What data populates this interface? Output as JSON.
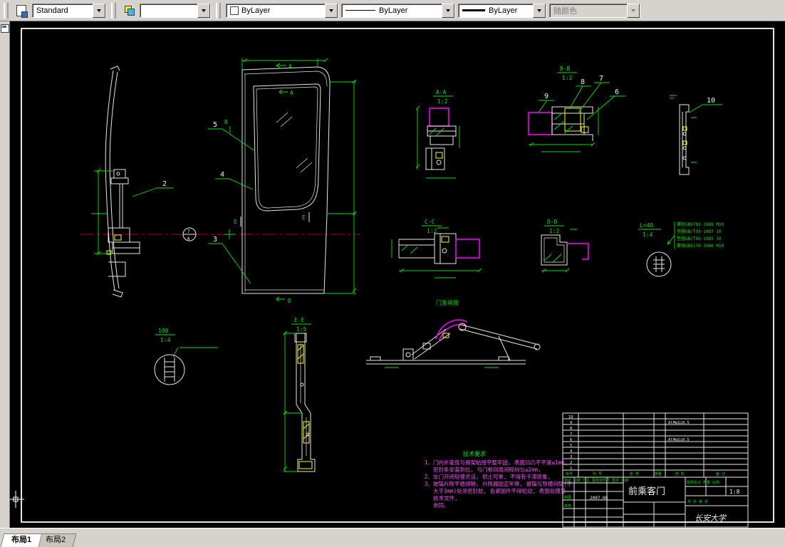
{
  "toolbar": {
    "text_style": "Standard",
    "color": "ByLayer",
    "linetype": "ByLayer",
    "lineweight": "ByLayer",
    "plot_style": "随颜色"
  },
  "tabs": {
    "layout1": "布局1",
    "layout2": "布局2"
  },
  "callouts": {
    "c2": "2",
    "c3": "3",
    "c4": "4",
    "c5": "5",
    "c6": "6",
    "c7": "7",
    "c8": "8",
    "c9": "9",
    "c10": "10"
  },
  "sections": {
    "aa_name": "A-A",
    "aa_scale": "1:2",
    "bb_name": "B-B",
    "bb_scale": "1:2",
    "cc_name": "C-C",
    "cc_scale": "1:2",
    "dd_name": "D-D",
    "dd_scale": "1:2",
    "ee_name": "E-E",
    "ee_scale": "1:5",
    "left_detail_dim": "100",
    "left_detail_scale": "1:4",
    "bolt_detail_dim": "L=40",
    "bolt_detail_scale": "1:4"
  },
  "marks": {
    "a_top": "A",
    "a_window": "A",
    "b_left": "B",
    "d_bottom": "D",
    "e_left": "E",
    "e_right": "E",
    "datum_top": "7",
    "datum_bottom": "6"
  },
  "bolt_parts": {
    "p1": "螺栓GB5783-1986 M10",
    "p2": "垫圈GB/T93-1987 10",
    "p3": "垫圈GB/T95-1985 10",
    "p4": "螺母GB6170-1986 M10"
  },
  "pump_label": "门泵吊臂",
  "notes": {
    "title": "技术要求",
    "l1": "1、门内外蒙皮与骨架粘接平整牢固, 表面凹凸不平度≤1mm,",
    "l2": "　 密封条安装到位, 与门框四周间隙均匀≤2mm,",
    "l3": "2、车门开闭轻便灵活, 锁止可靠, 不得有卡滞现象,",
    "l4": "3、玻璃升降平稳顺畅, 升降器固定牢靠, 玻璃与导槽间隙(不",
    "l5": "　 大于3mm)处涂密封胶, 各紧固件不得松动, 表面处理见",
    "l6": "　 技术文件,",
    "l7": "　 余同。"
  },
  "title_block": {
    "r10": "10",
    "r9": "9",
    "r8": "8",
    "r7": "7",
    "r6": "6",
    "r5": "5",
    "r4": "4",
    "r3": "3",
    "r2": "2",
    "r1": "1",
    "mat_a": "AlMgSi0.5",
    "mat_b": "AlMgSi0.5",
    "h_seq": "序号",
    "h_code": "代 号",
    "h_name": "名 称",
    "h_qty": "数量",
    "h_mat": "材 料",
    "h_note": "备 注",
    "micro_header": "标记 处数 分区 更改文件号 签字 日期",
    "sign1": "制图",
    "sign2": "校核",
    "date": "2007.08",
    "title": "前乘客门",
    "r_header": "图样标记 质量 比例",
    "scale": "1:8",
    "sheet": "共 张 第 张",
    "org": "长安大学"
  }
}
